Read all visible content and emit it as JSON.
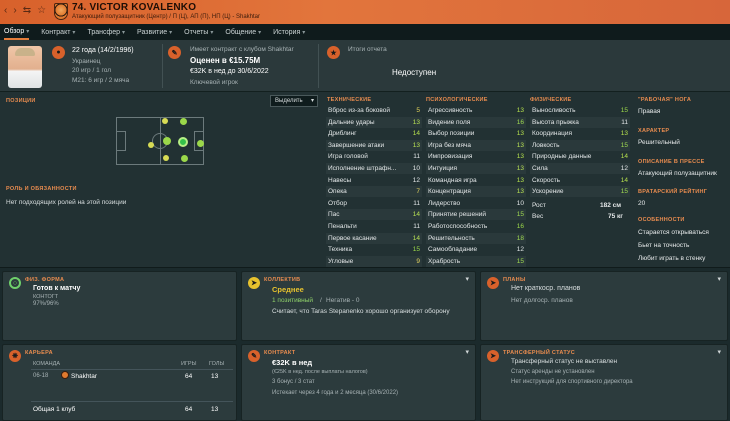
{
  "header": {
    "player_name": "74. VICTOR KOVALENKO",
    "player_subtitle": "Атакующий полузащитник (Центр) / П (Ц), АП (П), НП (Ц) - Shakhtar",
    "colors": {
      "accent": "#d8612b",
      "positive": "#9bd84a"
    }
  },
  "tabs": [
    {
      "label": "Обзор"
    },
    {
      "label": "Контракт"
    },
    {
      "label": "Трансфер"
    },
    {
      "label": "Развитие"
    },
    {
      "label": "Отчеты"
    },
    {
      "label": "Общение"
    },
    {
      "label": "История"
    }
  ],
  "profile": {
    "age": "22 года (14/2/1996)",
    "nationality": "Украинец",
    "caps": "20 игр / 1 гол",
    "u21": "М21: 6 игр / 2 мяча"
  },
  "contract_top": {
    "line1": "Имеет контракт с клубом Shakhtar",
    "valued": "Оценен в €15.75M",
    "wage": "€32K в нед до 30/6/2022",
    "role": "Ключевой игрок"
  },
  "report": {
    "title": "Итоги отчета",
    "status": "Недоступен"
  },
  "position": {
    "title": "ПОЗИЦИИ",
    "select_label": "Выделить",
    "roles_title": "РОЛЬ И ОБЯЗАННОСТИ",
    "roles_text": "Нет подходящих ролей на этой позиции"
  },
  "technical": {
    "title": "ТЕХНИЧЕСКИЕ",
    "rows": [
      {
        "name": "Вброс из-за боковой",
        "value": "5"
      },
      {
        "name": "Дальние удары",
        "value": "13"
      },
      {
        "name": "Дриблинг",
        "value": "14"
      },
      {
        "name": "Завершение атаки",
        "value": "13"
      },
      {
        "name": "Игра головой",
        "value": "11"
      },
      {
        "name": "Исполнение штрафн...",
        "value": "10"
      },
      {
        "name": "Навесы",
        "value": "12"
      },
      {
        "name": "Опека",
        "value": "7"
      },
      {
        "name": "Отбор",
        "value": "11"
      },
      {
        "name": "Пас",
        "value": "14"
      },
      {
        "name": "Пенальти",
        "value": "11"
      },
      {
        "name": "Первое касание",
        "value": "14"
      },
      {
        "name": "Техника",
        "value": "15"
      },
      {
        "name": "Угловые",
        "value": "9"
      }
    ]
  },
  "mental": {
    "title": "ПСИХОЛОГИЧЕСКИЕ",
    "rows": [
      {
        "name": "Агрессивность",
        "value": "13"
      },
      {
        "name": "Видение поля",
        "value": "16"
      },
      {
        "name": "Выбор позиции",
        "value": "13"
      },
      {
        "name": "Игра без мяча",
        "value": "13"
      },
      {
        "name": "Импровизация",
        "value": "13"
      },
      {
        "name": "Интуиция",
        "value": "13"
      },
      {
        "name": "Командная игра",
        "value": "13"
      },
      {
        "name": "Концентрация",
        "value": "13"
      },
      {
        "name": "Лидерство",
        "value": "10"
      },
      {
        "name": "Принятие решений",
        "value": "15"
      },
      {
        "name": "Работоспособность",
        "value": "16"
      },
      {
        "name": "Решительность",
        "value": "18"
      },
      {
        "name": "Самообладание",
        "value": "12"
      },
      {
        "name": "Храбрость",
        "value": "15"
      }
    ]
  },
  "physical": {
    "title": "ФИЗИЧЕСКИЕ",
    "rows": [
      {
        "name": "Выносливость",
        "value": "15"
      },
      {
        "name": "Высота прыжка",
        "value": "11"
      },
      {
        "name": "Координация",
        "value": "13"
      },
      {
        "name": "Ловкость",
        "value": "15"
      },
      {
        "name": "Природные данные",
        "value": "14"
      },
      {
        "name": "Сила",
        "value": "12"
      },
      {
        "name": "Скорость",
        "value": "14"
      },
      {
        "name": "Ускорение",
        "value": "15"
      }
    ],
    "height_label": "Рост",
    "height_value": "182 см",
    "weight_label": "Вес",
    "weight_value": "75 кг"
  },
  "side": {
    "foot_title": "\"РАБОЧАЯ\" НОГА",
    "foot_value": "Правая",
    "character_title": "ХАРАКТЕР",
    "character_value": "Решительный",
    "press_title": "ОПИСАНИЕ В ПРЕССЕ",
    "press_value": "Атакующий полузащитник",
    "gk_title": "ВРАТАРСКИЙ РЕЙТИНГ",
    "gk_value": "20",
    "traits_title": "ОСОБЕННОСТИ",
    "traits": [
      "Старается открываться",
      "Бьет на точность",
      "Любит играть в стенку"
    ]
  },
  "fitness": {
    "title": "ФИЗ. ФОРМА",
    "status": "Готов к матчу",
    "label": "КОНТОГТ",
    "value": "97%/96%"
  },
  "collective": {
    "title": "КОЛЛЕКТИВ",
    "status": "Среднее",
    "positive": "1 позитивный",
    "negative": "Негатив - 0",
    "comment": "Считает, что Taras Stepanenko хорошо организует оборону"
  },
  "plans": {
    "title": "ПЛАНЫ",
    "short": "Нет краткоср. планов",
    "long": "Нет долгоср. планов"
  },
  "career": {
    "title": "КАРЬЕРА",
    "col_team": "КОМАНДА",
    "col_games": "ИГРЫ",
    "col_goals": "ГОЛЫ",
    "rows": [
      {
        "years": "06-18",
        "team": "Shakhtar",
        "games": "64",
        "goals": "13"
      }
    ],
    "total_label": "Общая 1 клуб",
    "total_games": "64",
    "total_goals": "13"
  },
  "contract": {
    "title": "КОНТРАКТ",
    "wage": "€32K в нед",
    "wage_after_tax": "(€25K в нед. после выплаты налогов)",
    "bonuses": "3 бонус / 3 стат",
    "expires": "Истекает через 4 года и 2 месяца (30/6/2022)"
  },
  "transfer": {
    "title": "ТРАНСФЕРНЫЙ СТАТУС",
    "line1": "Трансферный статус не выставлен",
    "line2": "Статус аренды не установлен",
    "line3": "Нет инструкций для спортивного директора"
  }
}
